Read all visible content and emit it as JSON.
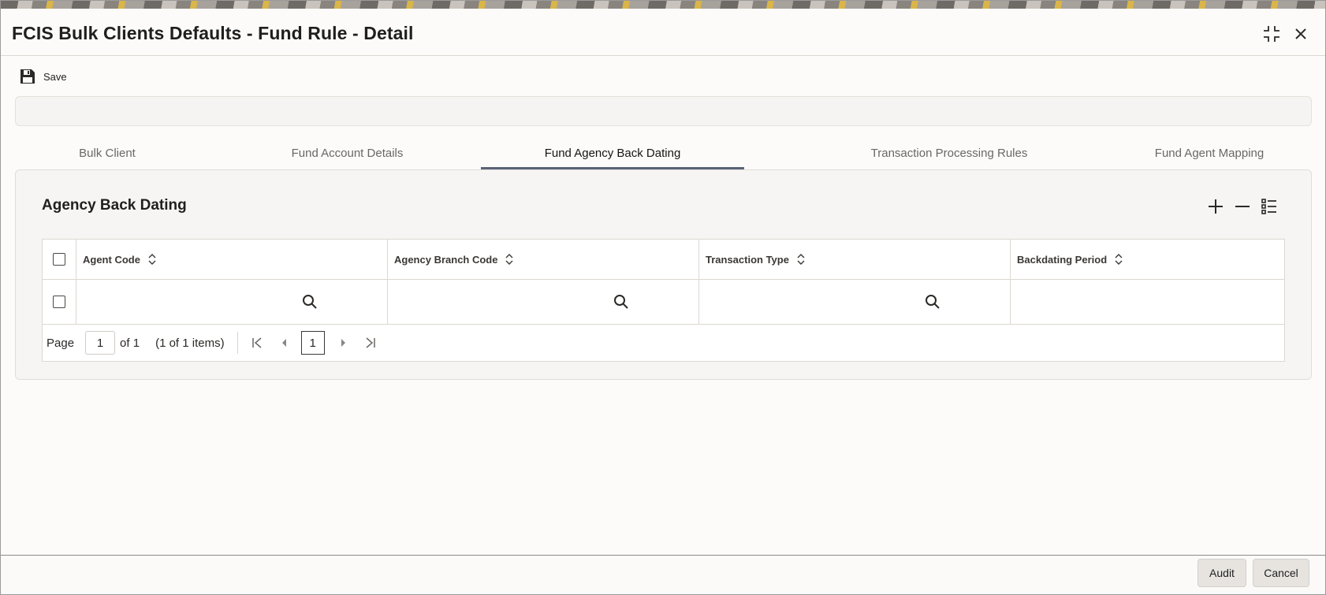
{
  "window": {
    "title": "FCIS Bulk Clients Defaults - Fund Rule - Detail",
    "maximize_icon": "maximize-icon",
    "close_icon": "close-icon"
  },
  "toolbar": {
    "save_label": "Save",
    "save_icon": "floppy-disk-icon"
  },
  "tabs": [
    {
      "label": "Bulk Client",
      "active": false
    },
    {
      "label": "Fund Account Details",
      "active": false
    },
    {
      "label": "Fund Agency Back Dating",
      "active": true
    },
    {
      "label": "Transaction Processing Rules",
      "active": false
    },
    {
      "label": "Fund Agent Mapping",
      "active": false
    }
  ],
  "section": {
    "title": "Agency Back Dating",
    "actions": [
      "add-icon",
      "remove-icon",
      "list-view-icon"
    ]
  },
  "grid": {
    "columns": [
      {
        "label": "Agent Code",
        "sortable": true
      },
      {
        "label": "Agency Branch Code",
        "sortable": true
      },
      {
        "label": "Transaction Type",
        "sortable": true
      },
      {
        "label": "Backdating Period",
        "sortable": true
      }
    ],
    "rows": [
      {
        "agent_code": "",
        "agency_branch_code": "",
        "transaction_type": "",
        "backdating_period": ""
      }
    ]
  },
  "pager": {
    "page_label": "Page",
    "page_value": "1",
    "of_label": "of 1",
    "count_label": "(1 of 1 items)",
    "current_page": "1"
  },
  "footer": {
    "audit_label": "Audit",
    "cancel_label": "Cancel"
  },
  "colors": {
    "active_tab_underline": "#5a6377",
    "panel_background": "#f6f5f3"
  }
}
